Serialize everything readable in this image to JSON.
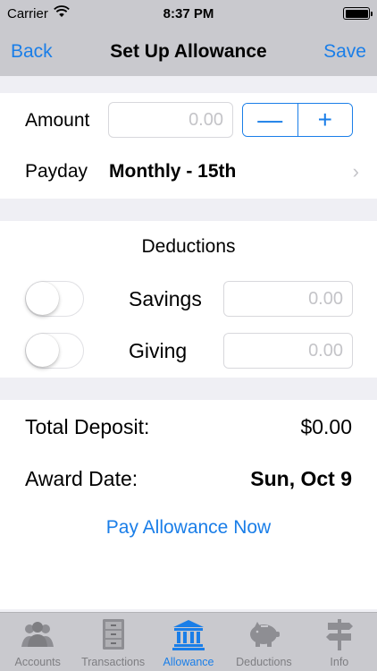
{
  "status_bar": {
    "carrier": "Carrier",
    "time": "8:37 PM"
  },
  "nav": {
    "back_label": "Back",
    "title": "Set Up Allowance",
    "save_label": "Save"
  },
  "amount": {
    "label": "Amount",
    "placeholder": "0.00",
    "minus": "—",
    "plus": "+"
  },
  "payday": {
    "label": "Payday",
    "value": "Monthly - 15th",
    "chevron": "›"
  },
  "deductions": {
    "title": "Deductions",
    "items": [
      {
        "label": "Savings",
        "placeholder": "0.00",
        "enabled": false
      },
      {
        "label": "Giving",
        "placeholder": "0.00",
        "enabled": false
      }
    ]
  },
  "summary": {
    "total_label": "Total Deposit:",
    "total_value": "$0.00",
    "award_label": "Award Date:",
    "award_value": "Sun, Oct 9",
    "pay_now": "Pay Allowance Now"
  },
  "tabs": [
    {
      "label": "Accounts",
      "icon": "people-icon",
      "active": false
    },
    {
      "label": "Transactions",
      "icon": "cabinet-icon",
      "active": false
    },
    {
      "label": "Allowance",
      "icon": "bank-icon",
      "active": true
    },
    {
      "label": "Deductions",
      "icon": "piggy-bank-icon",
      "active": false
    },
    {
      "label": "Info",
      "icon": "signpost-icon",
      "active": false
    }
  ],
  "colors": {
    "accent": "#1a7ee8",
    "bar": "#c9c9ce",
    "inactive_tab": "#7e7e82"
  }
}
